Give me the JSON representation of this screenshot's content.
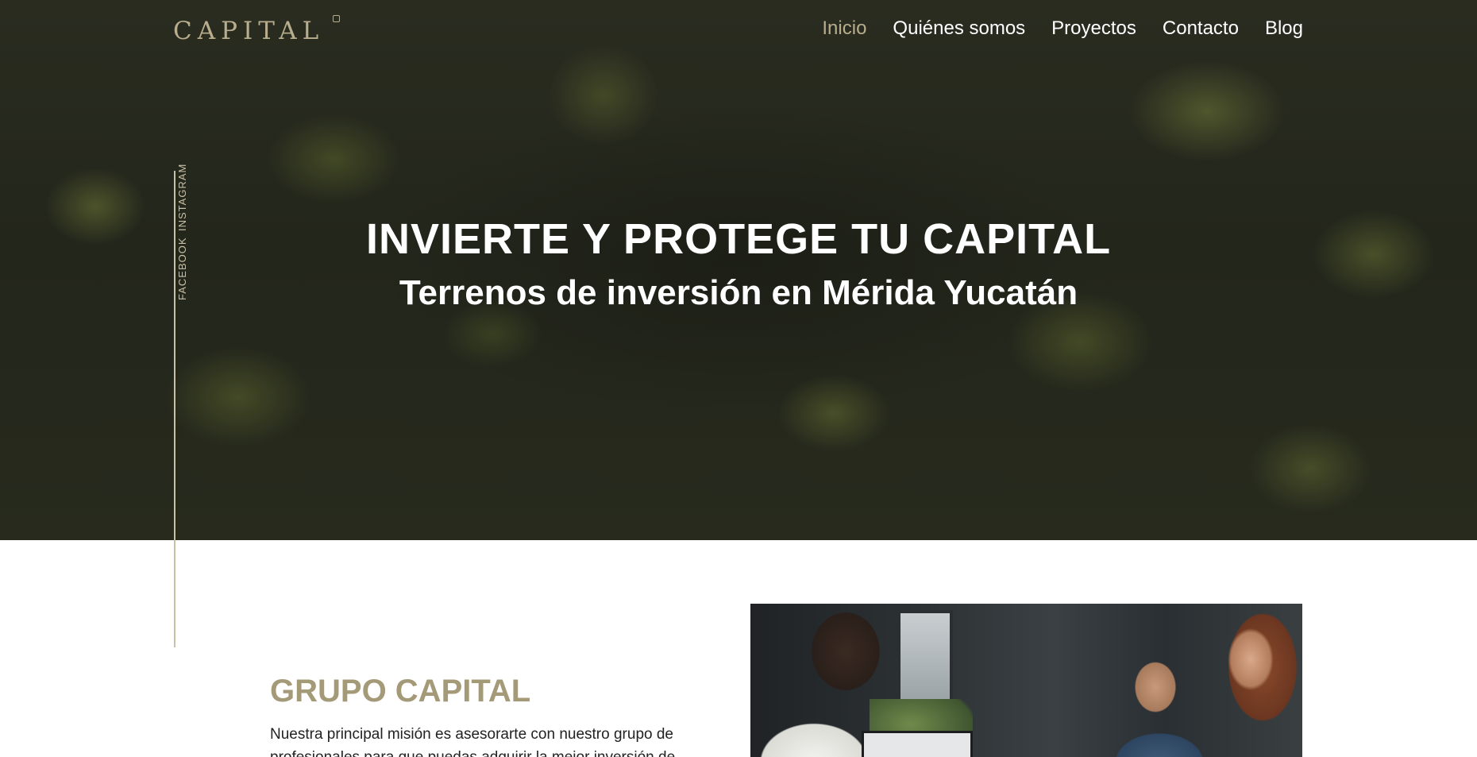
{
  "header": {
    "logo_text": "CAPITAL",
    "nav": [
      {
        "label": "Inicio",
        "active": true
      },
      {
        "label": "Quiénes somos",
        "active": false
      },
      {
        "label": "Proyectos",
        "active": false
      },
      {
        "label": "Contacto",
        "active": false
      },
      {
        "label": "Blog",
        "active": false
      }
    ]
  },
  "social": {
    "instagram": "INSTAGRAM",
    "facebook": "FACEBOOK"
  },
  "hero": {
    "title": "INVIERTE Y PROTEGE TU CAPITAL",
    "subtitle": "Terrenos de inversión en Mérida Yucatán"
  },
  "about": {
    "heading": "GRUPO CAPITAL",
    "text": "Nuestra principal misión es asesorarte con nuestro grupo de profesionales para que puedas adquirir la mejor inversión de acuerdo a"
  },
  "colors": {
    "accent": "#b8ad8d",
    "heading": "#a49a78",
    "hero_bg": "#252719"
  }
}
